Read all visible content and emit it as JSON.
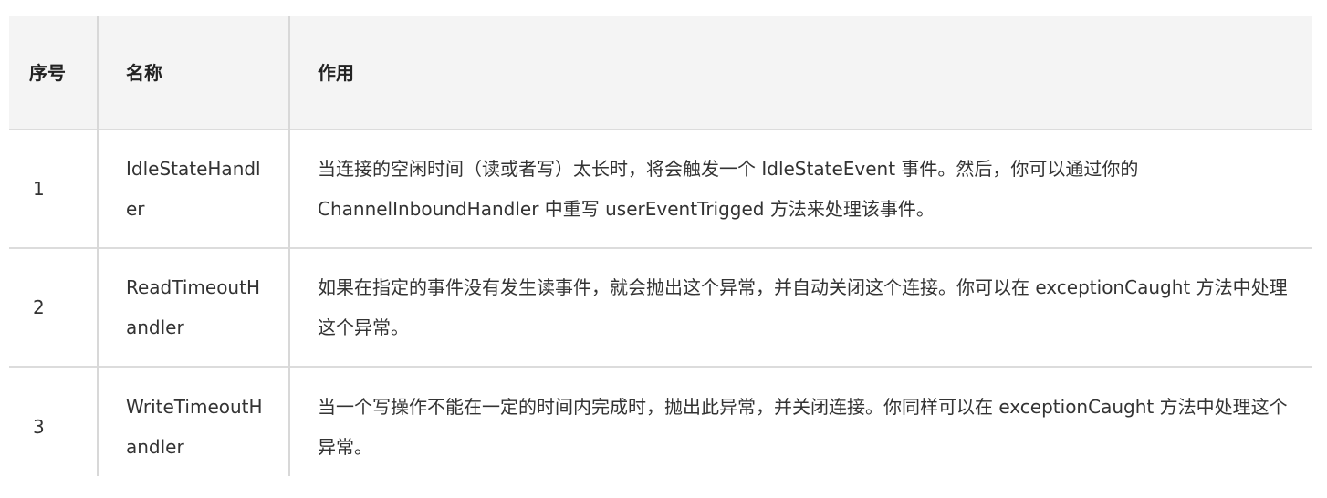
{
  "table": {
    "headers": {
      "index": "序号",
      "name": "名称",
      "purpose": "作用"
    },
    "rows": [
      {
        "index": "1",
        "name": "IdleStateHandler",
        "purpose": "当连接的空闲时间（读或者写）太长时，将会触发一个 IdleStateEvent 事件。然后，你可以通过你的 ChannelInboundHandler 中重写 userEventTrigged 方法来处理该事件。"
      },
      {
        "index": "2",
        "name": "ReadTimeoutHandler",
        "purpose": "如果在指定的事件没有发生读事件，就会抛出这个异常，并自动关闭这个连接。你可以在 exceptionCaught 方法中处理这个异常。"
      },
      {
        "index": "3",
        "name": "WriteTimeoutHandler",
        "purpose": "当一个写操作不能在一定的时间内完成时，抛出此异常，并关闭连接。你同样可以在 exceptionCaught 方法中处理这个异常。"
      }
    ]
  },
  "colors": {
    "header_background": "#f4f4f4",
    "border": "#dcdcdc",
    "text": "#333333"
  }
}
